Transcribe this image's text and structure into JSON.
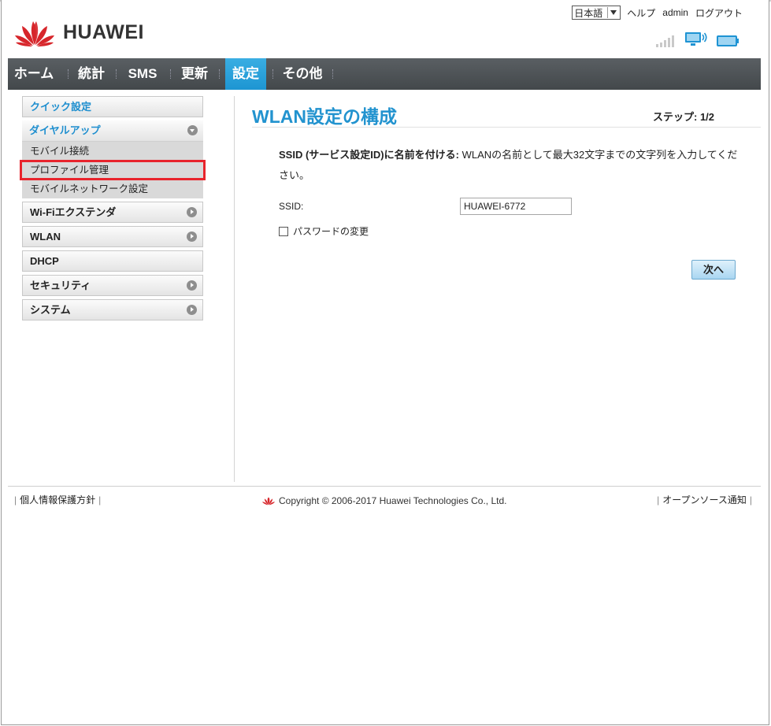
{
  "header": {
    "brand": "HUAWEI",
    "language": "日本語",
    "help": "ヘルプ",
    "user": "admin",
    "logout": "ログアウト"
  },
  "nav": {
    "items": [
      {
        "label": "ホーム"
      },
      {
        "label": "統計"
      },
      {
        "label": "SMS"
      },
      {
        "label": "更新"
      },
      {
        "label": "設定"
      },
      {
        "label": "その他"
      }
    ],
    "active": "設定"
  },
  "sidebar": {
    "quick": "クイック設定",
    "dialup": {
      "label": "ダイヤルアップ",
      "sub": [
        "モバイル接続",
        "プロファイル管理",
        "モバイルネットワーク設定"
      ]
    },
    "wifi_ext": "Wi-Fiエクステンダ",
    "wlan": "WLAN",
    "dhcp": "DHCP",
    "security": "セキュリティ",
    "system": "システム"
  },
  "main": {
    "title": "WLAN設定の構成",
    "step": "ステップ: 1/2",
    "desc_bold": "SSID (サービス設定ID)に名前を付ける:",
    "desc_text": " WLANの名前として最大32文字までの文字列を入力してください。",
    "ssid_label": "SSID:",
    "ssid_value": "HUAWEI-6772",
    "password_change": "パスワードの変更",
    "next": "次へ"
  },
  "footer": {
    "privacy": "個人情報保護方針",
    "copyright": "Copyright © 2006-2017 Huawei Technologies Co., Ltd.",
    "opensource": "オープンソース通知"
  },
  "colors": {
    "accent": "#2293cf",
    "nav_bg": "#4b5053",
    "highlight_box": "#e8242c",
    "logo_red": "#d7262b"
  }
}
